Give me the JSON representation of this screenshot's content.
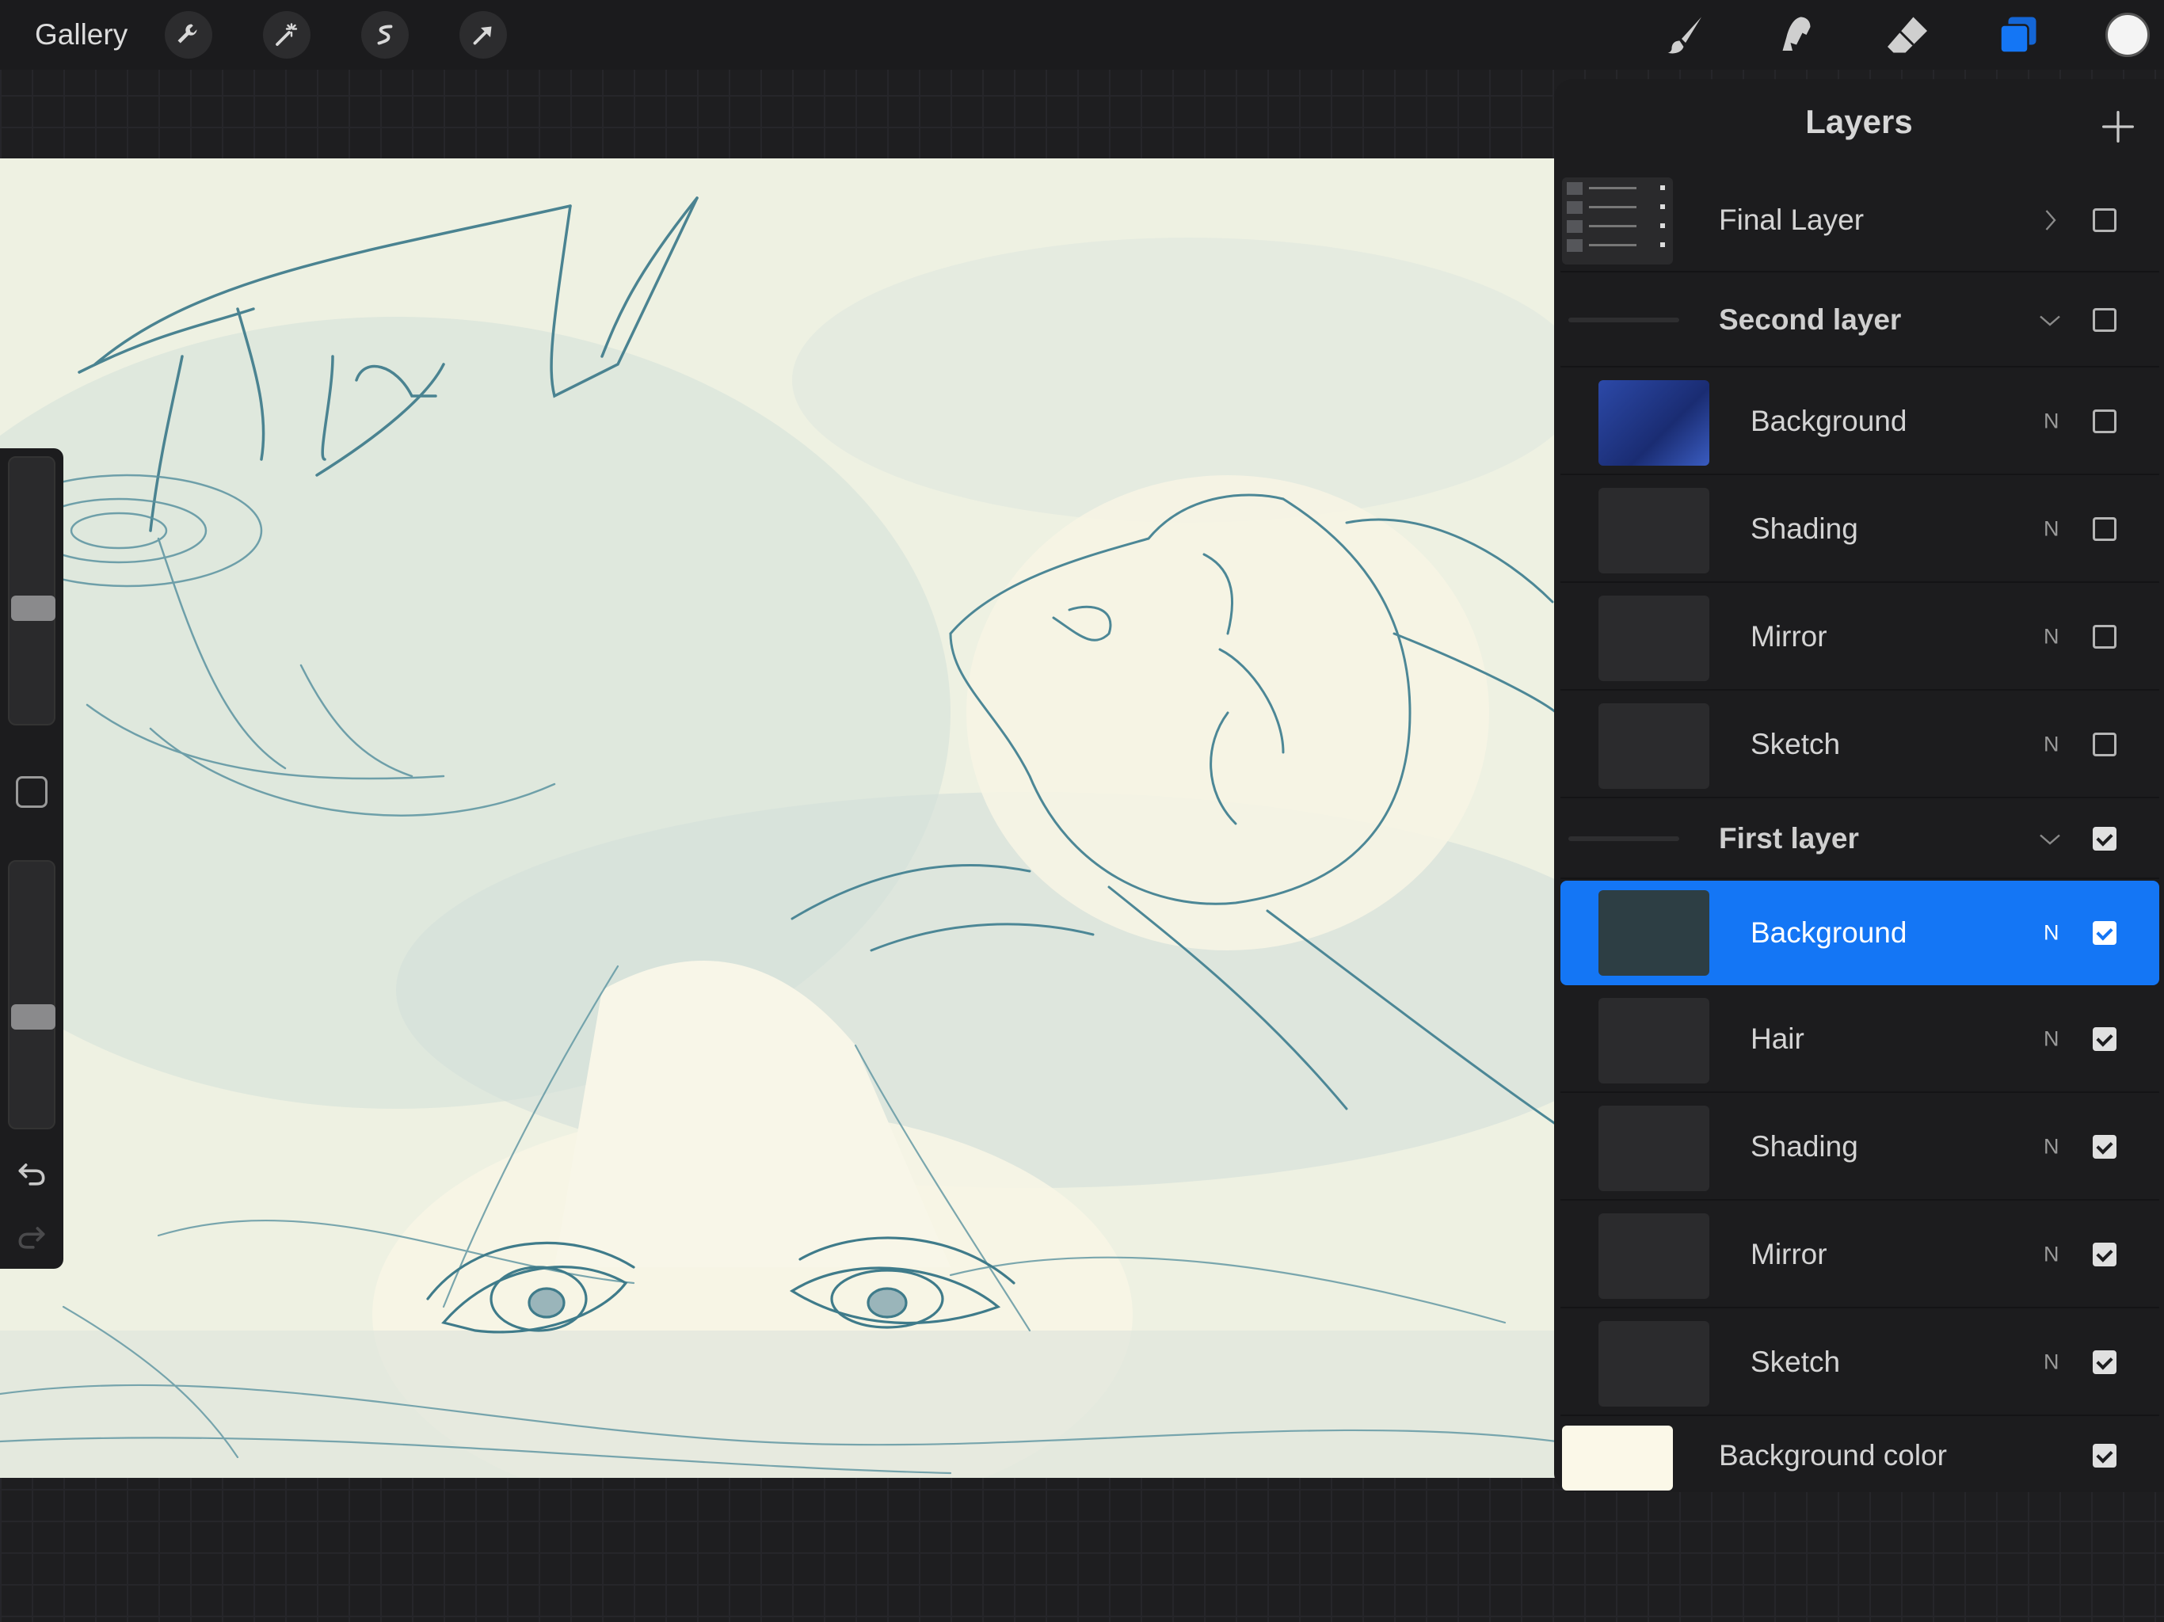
{
  "topbar": {
    "gallery_label": "Gallery",
    "tools_left": [
      "wrench-icon",
      "magic-wand-icon",
      "selection-icon",
      "transform-arrow-icon"
    ],
    "tools_right": [
      "brush-icon",
      "smudge-icon",
      "eraser-icon",
      "layers-icon"
    ],
    "active_tool": "layers-icon",
    "current_color": "#f4f4f4",
    "accent_color": "#1476f5"
  },
  "layers": {
    "title": "Layers",
    "rows": [
      {
        "kind": "top",
        "label": "Final Layer",
        "expanded": false,
        "visible": false
      },
      {
        "kind": "group",
        "label": "Second layer",
        "expanded": true,
        "visible": false
      },
      {
        "kind": "child",
        "label": "Background",
        "blend": "N",
        "visible": false,
        "thumb": "blue"
      },
      {
        "kind": "child",
        "label": "Shading",
        "blend": "N",
        "visible": false,
        "thumb": "dark"
      },
      {
        "kind": "child",
        "label": "Mirror",
        "blend": "N",
        "visible": false,
        "thumb": "dark"
      },
      {
        "kind": "child",
        "label": "Sketch",
        "blend": "N",
        "visible": false,
        "thumb": "dark"
      },
      {
        "kind": "group",
        "label": "First layer",
        "expanded": true,
        "visible": true
      },
      {
        "kind": "child",
        "label": "Background",
        "blend": "N",
        "visible": true,
        "selected": true,
        "thumb": "dark"
      },
      {
        "kind": "child",
        "label": "Hair",
        "blend": "N",
        "visible": true,
        "thumb": "dark"
      },
      {
        "kind": "child",
        "label": "Shading",
        "blend": "N",
        "visible": true,
        "thumb": "dark"
      },
      {
        "kind": "child",
        "label": "Mirror",
        "blend": "N",
        "visible": true,
        "thumb": "dark"
      },
      {
        "kind": "child",
        "label": "Sketch",
        "blend": "N",
        "visible": true,
        "thumb": "dark"
      },
      {
        "kind": "bgcolor",
        "label": "Background color",
        "visible": true,
        "thumb": "cream"
      }
    ]
  },
  "sidebar": {
    "brush_size_level": 0.58,
    "opacity_level": 0.6
  }
}
